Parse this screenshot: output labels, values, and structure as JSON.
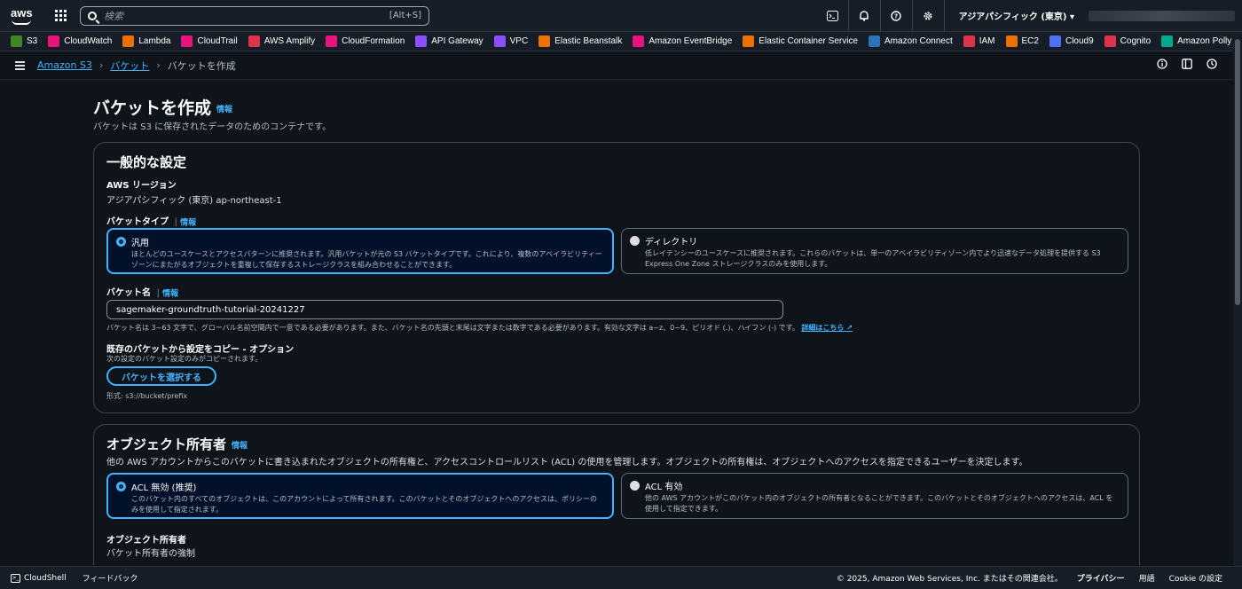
{
  "topbar": {
    "logo": "aws",
    "search_placeholder": "検索",
    "search_hint": "[Alt+S]",
    "region": "アジアパシフィック (東京) ▾"
  },
  "favorites": [
    {
      "label": "S3",
      "color": "#3f8624"
    },
    {
      "label": "CloudWatch",
      "color": "#e7157b"
    },
    {
      "label": "Lambda",
      "color": "#ed7100"
    },
    {
      "label": "CloudTrail",
      "color": "#e7157b"
    },
    {
      "label": "AWS Amplify",
      "color": "#dd344c"
    },
    {
      "label": "CloudFormation",
      "color": "#e7157b"
    },
    {
      "label": "API Gateway",
      "color": "#8c4fff"
    },
    {
      "label": "VPC",
      "color": "#8c4fff"
    },
    {
      "label": "Elastic Beanstalk",
      "color": "#ed7100"
    },
    {
      "label": "Amazon EventBridge",
      "color": "#e7157b"
    },
    {
      "label": "Elastic Container Service",
      "color": "#ed7100"
    },
    {
      "label": "Amazon Connect",
      "color": "#2e73b8"
    },
    {
      "label": "IAM",
      "color": "#dd344c"
    },
    {
      "label": "EC2",
      "color": "#ed7100"
    },
    {
      "label": "Cloud9",
      "color": "#4d72f3"
    },
    {
      "label": "Cognito",
      "color": "#dd344c"
    },
    {
      "label": "Amazon Polly",
      "color": "#01a88d"
    }
  ],
  "breadcrumb": {
    "items": [
      "Amazon S3",
      "バケット"
    ],
    "current": "バケットを作成"
  },
  "page": {
    "title": "バケットを作成",
    "info": "情報",
    "description": "バケットは S3 に保存されたデータのためのコンテナです。"
  },
  "general": {
    "heading": "一般的な設定",
    "region_label": "AWS リージョン",
    "region_value": "アジアパシフィック (東京) ap-northeast-1",
    "bucket_type_label": "バケットタイプ",
    "info": "情報",
    "type_general_title": "汎用",
    "type_general_desc": "ほとんどのユースケースとアクセスパターンに推奨されます。汎用バケットが元の S3 バケットタイプです。これにより、複数のアベイラビリティーゾーンにまたがるオブジェクトを重複して保存するストレージクラスを組み合わせることができます。",
    "type_directory_title": "ディレクトリ",
    "type_directory_desc": "低レイテンシーのユースケースに推奨されます。これらのバケットは、単一のアベイラビリティゾーン内でより迅速なデータ処理を提供する S3 Express One Zone ストレージクラスのみを使用します。",
    "bucket_name_label": "バケット名",
    "bucket_name_value": "sagemaker-groundtruth-tutorial-20241227",
    "bucket_name_hint": "バケット名は 3~63 文字で、グローバル名前空間内で一意である必要があります。また、バケット名の先頭と末尾は文字または数字である必要があります。有効な文字は a~z、0~9、ピリオド (.)、ハイフン (-) です。",
    "bucket_name_link": "詳細はこちら",
    "copy_label": "既存のバケットから設定をコピー - オプション",
    "copy_desc": "次の設定のバケット設定のみがコピーされます。",
    "choose_button": "バケットを選択する",
    "format_hint": "形式: s3://bucket/prefix"
  },
  "ownership": {
    "heading": "オブジェクト所有者",
    "info": "情報",
    "description": "他の AWS アカウントからこのバケットに書き込まれたオブジェクトの所有権と、アクセスコントロールリスト (ACL) の使用を管理します。オブジェクトの所有権は、オブジェクトへのアクセスを指定できるユーザーを決定します。",
    "acl_disabled_title": "ACL 無効 (推奨)",
    "acl_disabled_desc": "このバケット内のすべてのオブジェクトは、このアカウントによって所有されます。このバケットとそのオブジェクトへのアクセスは、ポリシーのみを使用して指定されます。",
    "acl_enabled_title": "ACL 有効",
    "acl_enabled_desc": "他の AWS アカウントがこのバケット内のオブジェクトの所有者となることができます。このバケットとそのオブジェクトへのアクセスは、ACL を使用して指定できます。",
    "owner_label": "オブジェクト所有者",
    "owner_value": "バケット所有者の強制"
  },
  "footer": {
    "cloudshell": "CloudShell",
    "feedback": "フィードバック",
    "copyright": "© 2025, Amazon Web Services, Inc. またはその関連会社。",
    "privacy": "プライバシー",
    "terms": "用語",
    "cookie": "Cookie の設定"
  }
}
